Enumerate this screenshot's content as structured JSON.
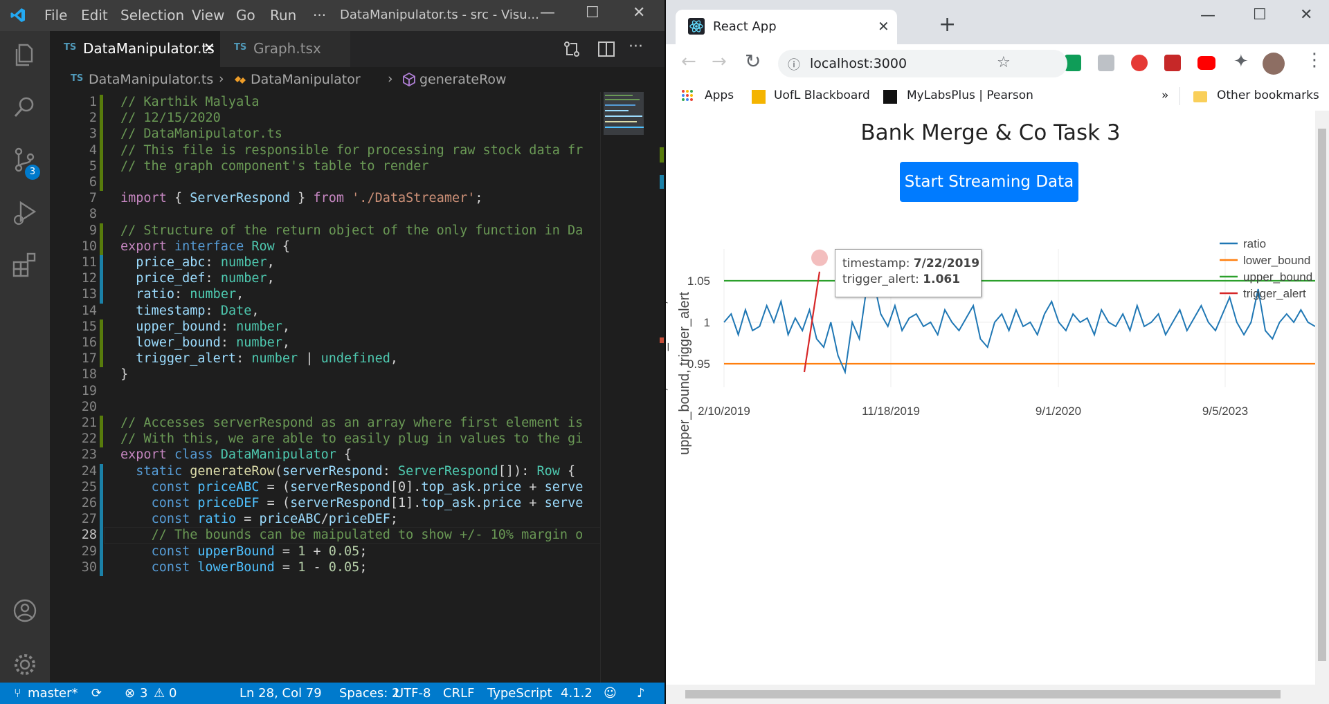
{
  "vscode": {
    "menu": [
      "File",
      "Edit",
      "Selection",
      "View",
      "Go",
      "Run",
      "···"
    ],
    "title": "DataManipulator.ts - src - Visu...",
    "activity_badge": "3",
    "tabs": [
      {
        "badge": "TS",
        "label": "DataManipulator.ts",
        "active": true
      },
      {
        "badge": "TS",
        "label": "Graph.tsx",
        "active": false
      }
    ],
    "breadcrumb": {
      "badge": "TS",
      "file": "DataManipulator.ts",
      "class": "DataManipulator",
      "method": "generateRow"
    },
    "active_line": 28,
    "lines": [
      {
        "n": 1,
        "t": [
          [
            "c-com",
            "// Karthik Malyala"
          ]
        ]
      },
      {
        "n": 2,
        "t": [
          [
            "c-com",
            "// 12/15/2020"
          ]
        ]
      },
      {
        "n": 3,
        "t": [
          [
            "c-com",
            "// DataManipulator.ts"
          ]
        ]
      },
      {
        "n": 4,
        "t": [
          [
            "c-com",
            "// This file is responsible for processing raw stock data fr"
          ]
        ]
      },
      {
        "n": 5,
        "t": [
          [
            "c-com",
            "// the graph component's table to render"
          ]
        ]
      },
      {
        "n": 6,
        "t": []
      },
      {
        "n": 7,
        "t": [
          [
            "c-kw2",
            "import"
          ],
          [
            "",
            "{ "
          ],
          [
            "c-var",
            "ServerRespond"
          ],
          [
            "",
            " } "
          ],
          [
            "c-kw2",
            "from"
          ],
          [
            "",
            ""
          ],
          [
            "c-str",
            "'./DataStreamer'"
          ],
          [
            "",
            ";"
          ]
        ]
      },
      {
        "n": 8,
        "t": []
      },
      {
        "n": 9,
        "t": [
          [
            "c-com",
            "// Structure of the return object of the only function in Da"
          ]
        ]
      },
      {
        "n": 10,
        "t": [
          [
            "c-kw2",
            "export"
          ],
          [
            "c-kw",
            "interface"
          ],
          [
            "c-type",
            "Row"
          ],
          [
            "",
            " {"
          ]
        ]
      },
      {
        "n": 11,
        "t": [
          [
            "",
            "  "
          ],
          [
            "c-var",
            "price_abc"
          ],
          [
            "",
            ": "
          ],
          [
            "c-type",
            "number"
          ],
          [
            "",
            ","
          ]
        ]
      },
      {
        "n": 12,
        "t": [
          [
            "",
            "  "
          ],
          [
            "c-var",
            "price_def"
          ],
          [
            "",
            ": "
          ],
          [
            "c-type",
            "number"
          ],
          [
            "",
            ","
          ]
        ]
      },
      {
        "n": 13,
        "t": [
          [
            "",
            "  "
          ],
          [
            "c-var",
            "ratio"
          ],
          [
            "",
            ": "
          ],
          [
            "c-type",
            "number"
          ],
          [
            "",
            ","
          ]
        ]
      },
      {
        "n": 14,
        "t": [
          [
            "",
            "  "
          ],
          [
            "c-var",
            "timestamp"
          ],
          [
            "",
            ": "
          ],
          [
            "c-type",
            "Date"
          ],
          [
            "",
            ","
          ]
        ]
      },
      {
        "n": 15,
        "t": [
          [
            "",
            "  "
          ],
          [
            "c-var",
            "upper_bound"
          ],
          [
            "",
            ": "
          ],
          [
            "c-type",
            "number"
          ],
          [
            "",
            ","
          ]
        ]
      },
      {
        "n": 16,
        "t": [
          [
            "",
            "  "
          ],
          [
            "c-var",
            "lower_bound"
          ],
          [
            "",
            ": "
          ],
          [
            "c-type",
            "number"
          ],
          [
            "",
            ","
          ]
        ]
      },
      {
        "n": 17,
        "t": [
          [
            "",
            "  "
          ],
          [
            "c-var",
            "trigger_alert"
          ],
          [
            "",
            ": "
          ],
          [
            "c-type",
            "number"
          ],
          [
            "",
            " | "
          ],
          [
            "c-type",
            "undefined"
          ],
          [
            "",
            ","
          ]
        ]
      },
      {
        "n": 18,
        "t": [
          [
            "",
            "}"
          ]
        ]
      },
      {
        "n": 19,
        "t": []
      },
      {
        "n": 20,
        "t": []
      },
      {
        "n": 21,
        "t": [
          [
            "c-com",
            "// Accesses serverRespond as an array where first element is"
          ]
        ]
      },
      {
        "n": 22,
        "t": [
          [
            "c-com",
            "// With this, we are able to easily plug in values to the gi"
          ]
        ]
      },
      {
        "n": 23,
        "t": [
          [
            "c-kw2",
            "export"
          ],
          [
            "c-kw",
            "class"
          ],
          [
            "c-type",
            "DataManipulator"
          ],
          [
            "",
            " {"
          ]
        ]
      },
      {
        "n": 24,
        "t": [
          [
            "",
            "  "
          ],
          [
            "c-kw",
            "static"
          ],
          [
            "c-fn",
            "generateRow"
          ],
          [
            "",
            "("
          ],
          [
            "c-var",
            "serverRespond"
          ],
          [
            "",
            ": "
          ],
          [
            "c-type",
            "ServerRespond"
          ],
          [
            "",
            "[]): "
          ],
          [
            "c-type",
            "Row"
          ],
          [
            "",
            " {"
          ]
        ]
      },
      {
        "n": 25,
        "t": [
          [
            "",
            "    "
          ],
          [
            "c-kw",
            "const"
          ],
          [
            "c-const",
            "priceABC"
          ],
          [
            "",
            " = ("
          ],
          [
            "c-var",
            "serverRespond"
          ],
          [
            "",
            "[0]."
          ],
          [
            "c-var",
            "top_ask"
          ],
          [
            "",
            "."
          ],
          [
            "c-var",
            "price"
          ],
          [
            "",
            " + "
          ],
          [
            "c-var",
            "serve"
          ]
        ]
      },
      {
        "n": 26,
        "t": [
          [
            "",
            "    "
          ],
          [
            "c-kw",
            "const"
          ],
          [
            "c-const",
            "priceDEF"
          ],
          [
            "",
            " = ("
          ],
          [
            "c-var",
            "serverRespond"
          ],
          [
            "",
            "[1]."
          ],
          [
            "c-var",
            "top_ask"
          ],
          [
            "",
            "."
          ],
          [
            "c-var",
            "price"
          ],
          [
            "",
            " + "
          ],
          [
            "c-var",
            "serve"
          ]
        ]
      },
      {
        "n": 27,
        "t": [
          [
            "",
            "    "
          ],
          [
            "c-kw",
            "const"
          ],
          [
            "c-const",
            "ratio"
          ],
          [
            "",
            " = "
          ],
          [
            "c-var",
            "priceABC"
          ],
          [
            "",
            "/"
          ],
          [
            "c-var",
            "priceDEF"
          ],
          [
            "",
            ";"
          ]
        ]
      },
      {
        "n": 28,
        "t": [
          [
            "",
            "    "
          ],
          [
            "c-com",
            "// The bounds can be maipulated to show +/- 10% margin o"
          ]
        ]
      },
      {
        "n": 29,
        "t": [
          [
            "",
            "    "
          ],
          [
            "c-kw",
            "const"
          ],
          [
            "c-const",
            "upperBound"
          ],
          [
            "",
            " = "
          ],
          [
            "c-num",
            "1"
          ],
          [
            "",
            " + "
          ],
          [
            "c-num",
            "0.05"
          ],
          [
            "",
            ";"
          ]
        ]
      },
      {
        "n": 30,
        "t": [
          [
            "",
            "    "
          ],
          [
            "c-kw",
            "const"
          ],
          [
            "c-const",
            "lowerBound"
          ],
          [
            "",
            " = "
          ],
          [
            "c-num",
            "1"
          ],
          [
            "",
            " - "
          ],
          [
            "c-num",
            "0.05"
          ],
          [
            "",
            ";"
          ]
        ]
      }
    ],
    "status": {
      "branch": "master*",
      "errors": "3",
      "warnings": "0",
      "position": "Ln 28, Col 79",
      "spaces": "Spaces: 2",
      "encoding": "UTF-8",
      "eol": "CRLF",
      "language": "TypeScript",
      "version": "4.1.2"
    }
  },
  "chrome": {
    "tab_title": "React App",
    "url": "localhost:3000",
    "bookmarks": [
      "Apps",
      "UofL Blackboard",
      "MyLabsPlus | Pearson"
    ],
    "bookmarks_more": "»",
    "other_bookmarks": "Other bookmarks",
    "page_title": "Bank Merge & Co Task 3",
    "stream_button": "Start Streaming Data",
    "tooltip": {
      "timestamp_label": "timestamp:",
      "timestamp_value": "7/22/2019",
      "trigger_label": "trigger_alert:",
      "trigger_value": "1.061"
    }
  },
  "chart_data": {
    "type": "line",
    "ylabel_line1": "ratio, lower_bound,",
    "ylabel_line2": "upper_bound, trigger_alert",
    "xlabel": "",
    "x_ticks": [
      "2/10/2019",
      "11/18/2019",
      "9/1/2020",
      "9/5/2023"
    ],
    "y_ticks": [
      "0.95",
      "1",
      "1.05"
    ],
    "ylim": [
      0.93,
      1.08
    ],
    "grid": true,
    "legend_position": "top-right",
    "series": [
      {
        "name": "ratio",
        "color": "#1f77b4",
        "values": [
          1.0,
          1.01,
          0.985,
          1.015,
          0.99,
          0.995,
          1.02,
          1.0,
          1.025,
          0.985,
          1.005,
          0.99,
          1.015,
          0.98,
          0.97,
          1.0,
          0.96,
          0.94,
          1.0,
          0.98,
          1.04,
          1.05,
          1.01,
          0.995,
          1.02,
          0.99,
          1.005,
          1.01,
          0.995,
          1.0,
          0.985,
          1.015,
          1.0,
          0.99,
          1.005,
          1.02,
          0.98,
          0.97,
          1.0,
          1.01,
          0.99,
          1.015,
          0.995,
          1.0,
          0.985,
          1.01,
          1.025,
          1.0,
          0.99,
          1.01,
          1.0,
          1.005,
          0.985,
          1.015,
          1.0,
          0.995,
          1.01,
          0.99,
          1.02,
          0.995,
          1.0,
          1.01,
          0.985,
          1.0,
          1.015,
          0.99,
          1.005,
          1.02,
          1.0,
          0.99,
          1.01,
          1.03,
          1.0,
          0.985,
          1.0,
          1.04,
          0.99,
          0.98,
          1.0,
          1.01,
          1.0,
          1.015,
          1.0,
          0.995
        ]
      },
      {
        "name": "lower_bound",
        "color": "#ff7f0e",
        "values": [
          0.95
        ]
      },
      {
        "name": "upper_bound",
        "color": "#2ca02c",
        "values": [
          1.05
        ]
      },
      {
        "name": "trigger_alert",
        "color": "#d62728",
        "values": [
          0.94,
          1.061
        ]
      }
    ]
  }
}
